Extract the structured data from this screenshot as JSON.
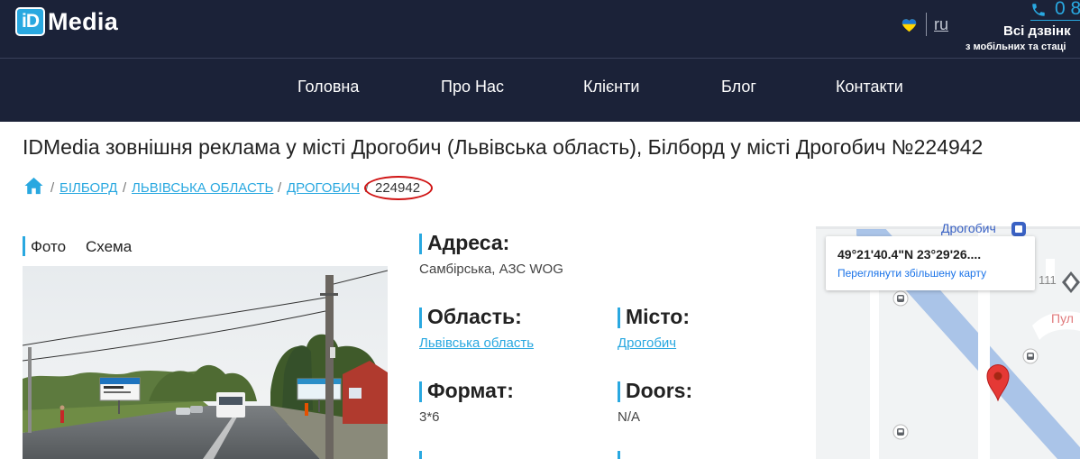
{
  "header": {
    "logo_box": "iD",
    "logo_text": "Media",
    "lang_link": "ru",
    "phone_number": "0 8",
    "calls_free": "Всі дзвінк",
    "calls_note": "з мобільних та стаці"
  },
  "nav": {
    "items": [
      "Головна",
      "Про Нас",
      "Клієнти",
      "Блог",
      "Контакти"
    ]
  },
  "page": {
    "title": "IDMedia зовнішня реклама у місті Дрогобич (Львівська область), Білборд у місті Дрогобич №224942"
  },
  "breadcrumb": {
    "sep": "/",
    "items": [
      "БІЛБОРД",
      "ЛЬВІВСЬКА ОБЛАСТЬ",
      "ДРОГОБИЧ"
    ],
    "current": "224942"
  },
  "tabs": [
    "Фото",
    "Схема"
  ],
  "details": {
    "address_label": "Адреса:",
    "address_value": "Самбірська, АЗС WOG",
    "region_label": "Область:",
    "region_value": "Львівська область",
    "city_label": "Місто:",
    "city_value": "Дрогобич",
    "format_label": "Формат:",
    "format_value": "3*6",
    "doors_label": "Doors:",
    "doors_value": "N/A"
  },
  "map": {
    "coords": "49°21'40.4\"N 23°29'26....",
    "view_larger": "Переглянути збільшену карту",
    "city_label": "Дрогобич",
    "road_number": "111",
    "partial_label": "Пул"
  },
  "colors": {
    "header_bg": "#1b2238",
    "accent": "#29a8e0",
    "highlight_oval": "#d01414",
    "map_pin": "#e53935"
  }
}
